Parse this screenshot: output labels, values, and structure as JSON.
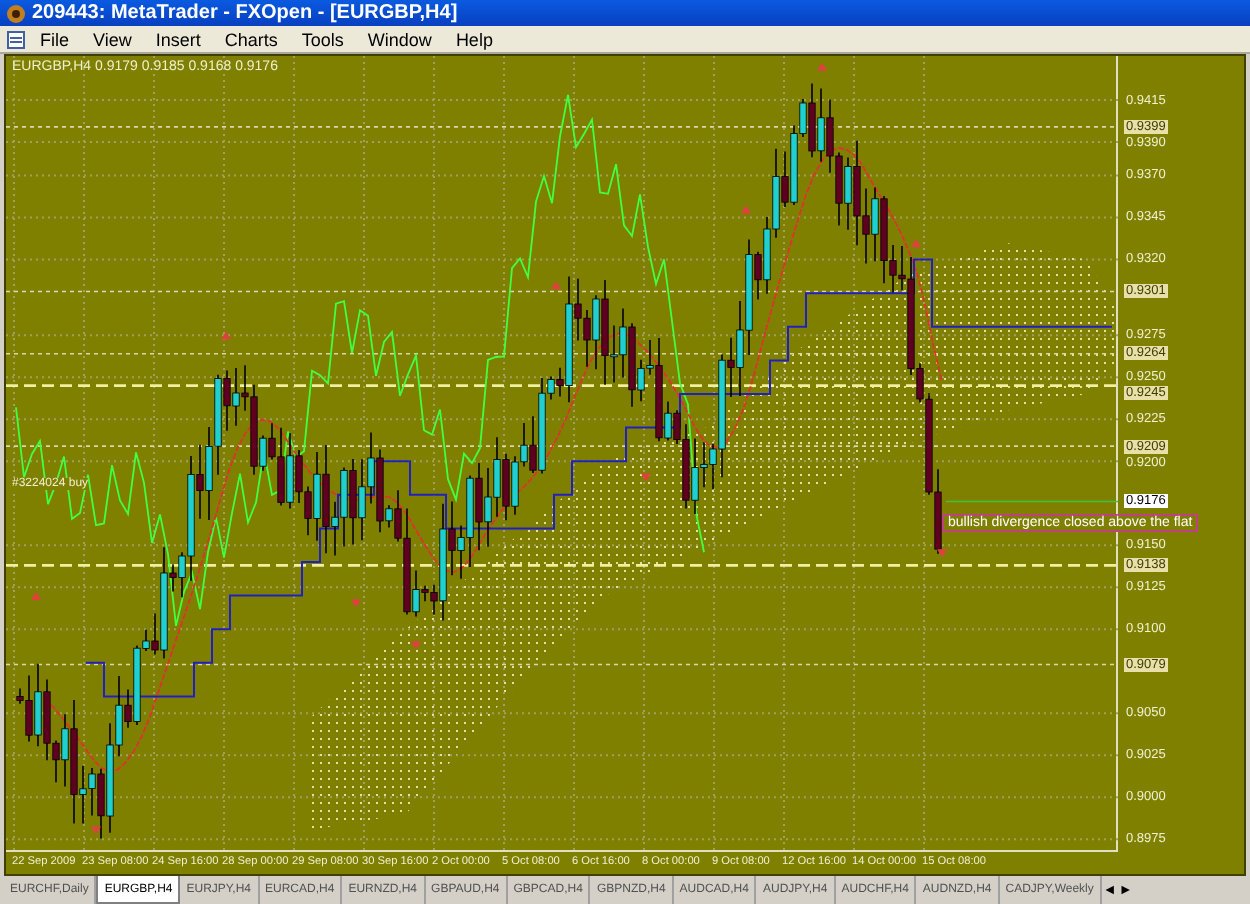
{
  "window": {
    "title": "209443: MetaTrader - FXOpen - [EURGBP,H4]"
  },
  "menu": [
    "File",
    "View",
    "Insert",
    "Charts",
    "Tools",
    "Window",
    "Help"
  ],
  "chart": {
    "info": "EURGBP,H4 0.9179 0.9185 0.9168 0.9176",
    "order_label": "#3224024 buy",
    "annotation": "bullish divergence closed above the flat",
    "price_axis": [
      {
        "label": "0.9415",
        "kind": "tick"
      },
      {
        "label": "0.9399",
        "kind": "level"
      },
      {
        "label": "0.9390",
        "kind": "tick"
      },
      {
        "label": "0.9370",
        "kind": "tick"
      },
      {
        "label": "0.9345",
        "kind": "tick"
      },
      {
        "label": "0.9320",
        "kind": "tick"
      },
      {
        "label": "0.9301",
        "kind": "level"
      },
      {
        "label": "0.9275",
        "kind": "tick"
      },
      {
        "label": "0.9264",
        "kind": "level"
      },
      {
        "label": "0.9250",
        "kind": "tick"
      },
      {
        "label": "0.9245",
        "kind": "level"
      },
      {
        "label": "0.9225",
        "kind": "tick"
      },
      {
        "label": "0.9209",
        "kind": "level"
      },
      {
        "label": "0.9200",
        "kind": "tick"
      },
      {
        "label": "0.9176",
        "kind": "bid"
      },
      {
        "label": "0.9150",
        "kind": "tick"
      },
      {
        "label": "0.9138",
        "kind": "level"
      },
      {
        "label": "0.9125",
        "kind": "tick"
      },
      {
        "label": "0.9100",
        "kind": "tick"
      },
      {
        "label": "0.9079",
        "kind": "level"
      },
      {
        "label": "0.9050",
        "kind": "tick"
      },
      {
        "label": "0.9025",
        "kind": "tick"
      },
      {
        "label": "0.9000",
        "kind": "tick"
      },
      {
        "label": "0.8975",
        "kind": "tick"
      }
    ],
    "time_axis": [
      "22 Sep 2009",
      "23 Sep 08:00",
      "24 Sep 16:00",
      "28 Sep 00:00",
      "29 Sep 08:00",
      "30 Sep 16:00",
      "2 Oct 00:00",
      "5 Oct 08:00",
      "6 Oct 16:00",
      "8 Oct 00:00",
      "9 Oct 08:00",
      "12 Oct 16:00",
      "14 Oct 00:00",
      "15 Oct 08:00"
    ]
  },
  "tabs": [
    {
      "label": "EURCHF,Daily",
      "selected": false
    },
    {
      "label": "EURGBP,H4",
      "selected": true
    },
    {
      "label": "EURJPY,H4",
      "selected": false
    },
    {
      "label": "EURCAD,H4",
      "selected": false
    },
    {
      "label": "EURNZD,H4",
      "selected": false
    },
    {
      "label": "GBPAUD,H4",
      "selected": false
    },
    {
      "label": "GBPCAD,H4",
      "selected": false
    },
    {
      "label": "GBPNZD,H4",
      "selected": false
    },
    {
      "label": "AUDCAD,H4",
      "selected": false
    },
    {
      "label": "AUDJPY,H4",
      "selected": false
    },
    {
      "label": "AUDCHF,H4",
      "selected": false
    },
    {
      "label": "AUDNZD,H4",
      "selected": false
    },
    {
      "label": "CADJPY,Weekly",
      "selected": false
    }
  ],
  "tab_scroll": [
    "◄",
    "►"
  ]
}
